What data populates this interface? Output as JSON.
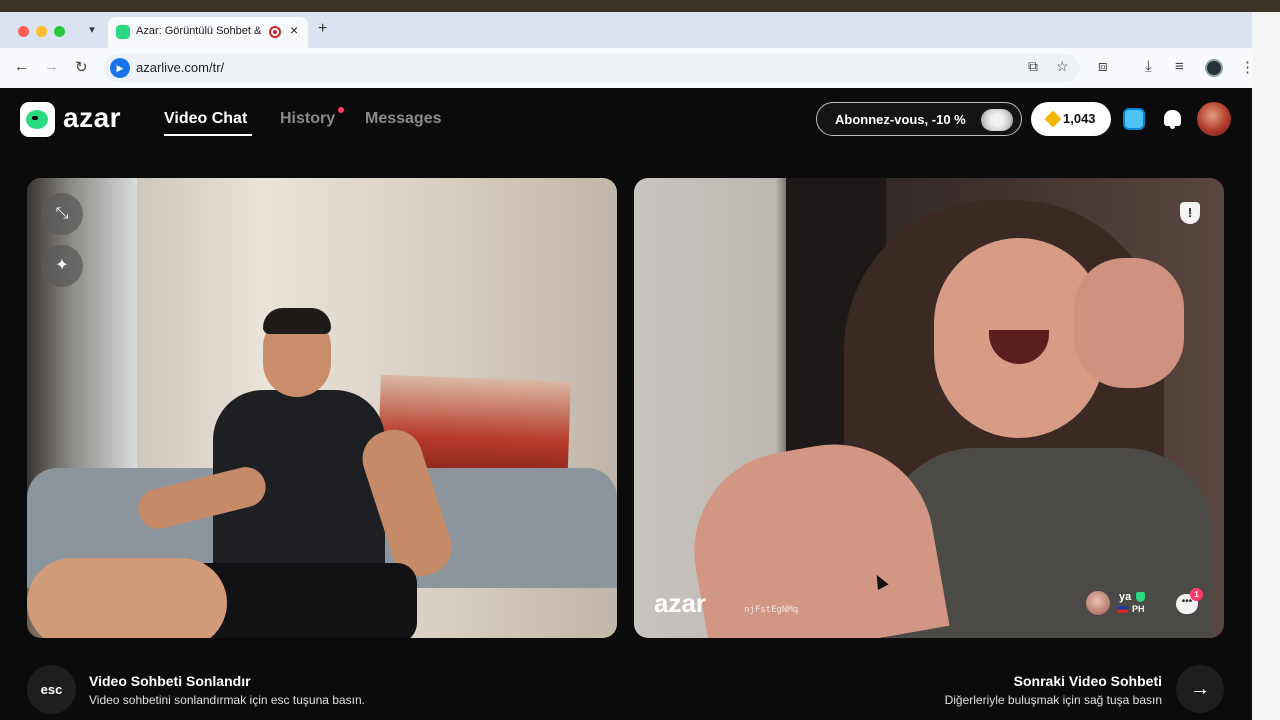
{
  "browser": {
    "tab_title": "Azar: Görüntülü Sohbet &",
    "url": "azarlive.com/tr/"
  },
  "header": {
    "logo_text": "azar",
    "nav": [
      {
        "label": "Video Chat",
        "active": true
      },
      {
        "label": "History",
        "active": false,
        "has_dot": true
      },
      {
        "label": "Messages",
        "active": false
      }
    ],
    "subscribe_label": "Abonnez-vous, -10 %",
    "gems_count": "1,043"
  },
  "video_right": {
    "watermark_logo": "azar",
    "watermark_id": "njFstEgNMq",
    "peer_name": "ya",
    "peer_country": "PH",
    "chat_badge_count": "1"
  },
  "footer": {
    "esc_key": "esc",
    "end_title": "Video Sohbeti Sonlandır",
    "end_subtitle": "Video sohbetini sonlandırmak için esc tuşuna basın.",
    "next_title": "Sonraki Video Sohbeti",
    "next_subtitle": "Diğerleriyle buluşmak için sağ tuşa basın"
  },
  "icons": {
    "minimize": "minimize-icon",
    "effects": "magic-wand-icon",
    "report": "report-icon",
    "chat": "chat-bubble-icon",
    "next": "arrow-right-icon"
  },
  "colors": {
    "brand_green": "#2bd982",
    "background": "#0b0b0b",
    "notification": "#ff3b6a",
    "gem": "#f5b400"
  }
}
